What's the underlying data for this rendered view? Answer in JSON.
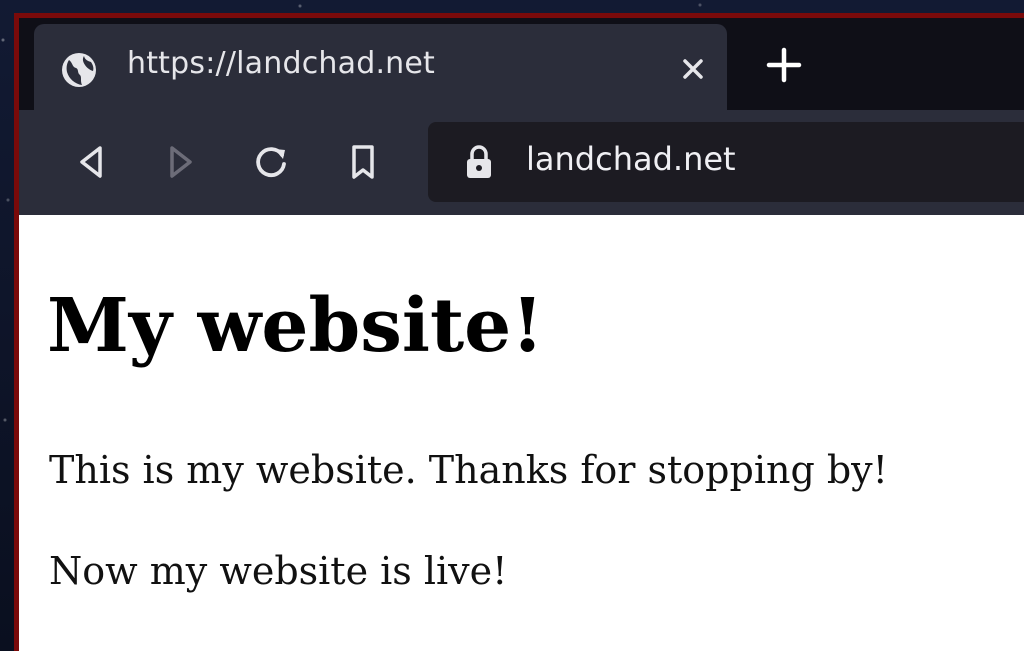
{
  "browser": {
    "tab": {
      "title": "https://landchad.net",
      "favicon": "globe-icon",
      "close_icon": "close-icon"
    },
    "new_tab_icon": "plus-icon",
    "toolbar": {
      "back_icon": "back-icon",
      "forward_icon": "forward-icon",
      "reload_icon": "reload-icon",
      "bookmark_icon": "bookmark-icon"
    },
    "address_bar": {
      "secure_icon": "lock-icon",
      "url": "landchad.net"
    },
    "colors": {
      "window_border": "#7a0a0a",
      "tab_strip": "#0f0f17",
      "toolbar": "#2b2d3a",
      "address_bar": "#1c1b22"
    }
  },
  "page": {
    "heading": "My website!",
    "paragraphs": [
      "This is my website. Thanks for stopping by!",
      "Now my website is live!"
    ]
  }
}
